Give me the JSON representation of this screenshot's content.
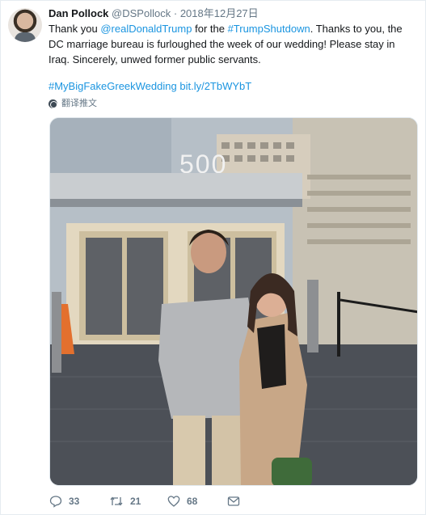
{
  "tweet": {
    "author_name": "Dan Pollock",
    "handle": "@DSPollock",
    "separator": "·",
    "date": "2018年12月27日",
    "text_parts": {
      "t1": "Thank you ",
      "mention": "@realDonaldTrump",
      "t2": " for the ",
      "hashtag": "#TrumpShutdown",
      "t3": ". Thanks to you, the DC marriage bureau is furloughed the week of our wedding! Please stay in Iraq. Sincerely, unwed former public servants."
    },
    "hashtag2": "#MyBigFakeGreekWedding",
    "short_link": "bit.ly/2TbWYbT",
    "translate_label": "翻译推文",
    "photo_sign": "500",
    "reply_count": "33",
    "retweet_count": "21",
    "like_count": "68"
  },
  "colors": {
    "link": "#1b95e0",
    "muted": "#657786",
    "text": "#14171a"
  },
  "icons": [
    "reply-icon",
    "retweet-icon",
    "heart-icon",
    "mail-icon",
    "globe-icon"
  ]
}
